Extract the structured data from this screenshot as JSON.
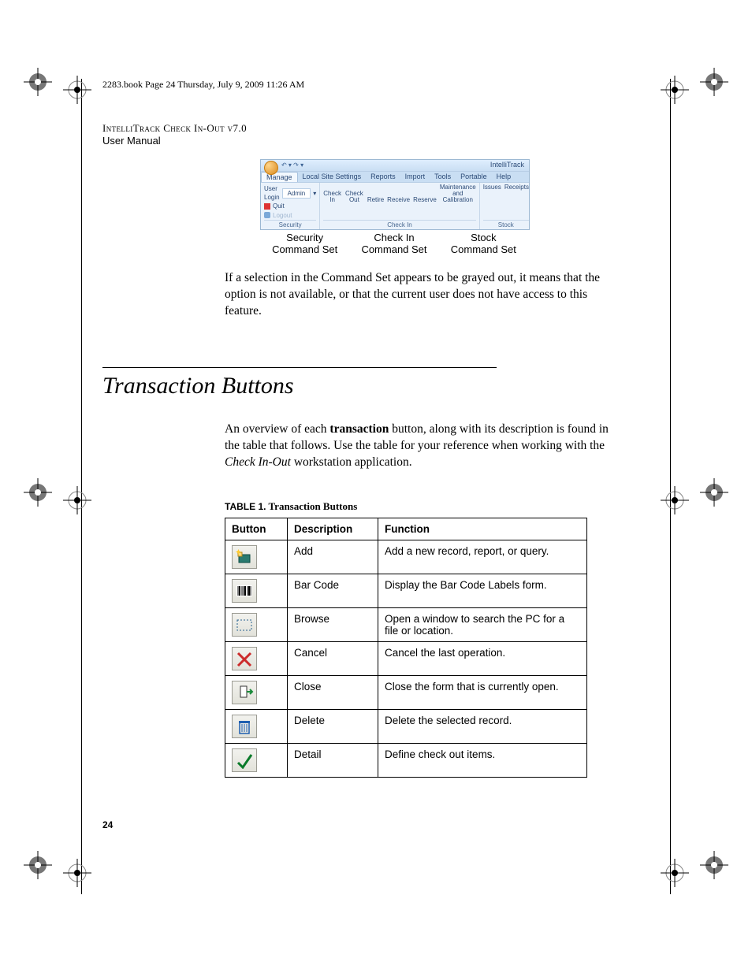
{
  "running_head": "2283.book  Page 24  Thursday, July 9, 2009  11:26 AM",
  "doc_title": "IntelliTrack Check In-Out v7.0",
  "doc_subtitle": "User Manual",
  "ribbon": {
    "app_name": "IntelliTrack",
    "qat": "↶ ▾  ↷     ▾",
    "tabs": [
      "Manage",
      "Local Site Settings",
      "Reports",
      "Import",
      "Tools",
      "Portable",
      "Help"
    ],
    "security": {
      "user_login_label": "User Login",
      "user_value": "Admin",
      "quit": "Quit",
      "logout": "Logout",
      "group_label": "Security"
    },
    "checkin": {
      "items": [
        "Check In",
        "Check Out",
        "Retire",
        "Receive",
        "Reserve",
        "Maintenance and Calibration"
      ],
      "group_label": "Check In"
    },
    "stock": {
      "items": [
        "Issues",
        "Receipts"
      ],
      "group_label": "Stock"
    }
  },
  "captions": {
    "c1a": "Security",
    "c1b": "Command Set",
    "c2a": "Check In",
    "c2b": "Command Set",
    "c3a": "Stock",
    "c3b": "Command Set"
  },
  "para1": "If a selection in the Command Set appears to be grayed out, it means that the option is not available, or that the current user does not have access to this feature.",
  "section_heading": "Transaction Buttons",
  "para2_a": "An overview of each ",
  "para2_bold": "transaction",
  "para2_b": " button, along with its description is found in the table that follows. Use the table for your reference when working with the ",
  "para2_ital": "Check In-Out",
  "para2_c": " workstation application.",
  "table_caption_label": "TABLE 1.",
  "table_caption_text": " Transaction Buttons",
  "table": {
    "headers": [
      "Button",
      "Description",
      "Function"
    ],
    "rows": [
      {
        "icon": "add",
        "desc": "Add",
        "func": "Add a new record, report, or query."
      },
      {
        "icon": "barcode",
        "desc": "Bar Code",
        "func": "Display the Bar Code Labels form."
      },
      {
        "icon": "browse",
        "desc": "Browse",
        "func": "Open a window to search the PC for a file or location."
      },
      {
        "icon": "cancel",
        "desc": "Cancel",
        "func": "Cancel the last operation."
      },
      {
        "icon": "close",
        "desc": "Close",
        "func": "Close the form that is currently open."
      },
      {
        "icon": "delete",
        "desc": "Delete",
        "func": "Delete the selected record."
      },
      {
        "icon": "detail",
        "desc": "Detail",
        "func": "Define check out items."
      }
    ]
  },
  "page_number": "24"
}
